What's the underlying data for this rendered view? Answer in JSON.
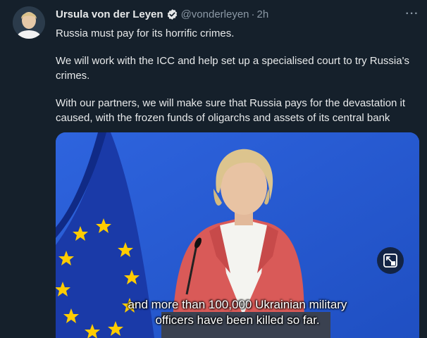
{
  "tweet": {
    "author_name": "Ursula von der Leyen",
    "handle": "@vonderleyen",
    "separator": "·",
    "time": "2h",
    "more_label": "···",
    "paragraphs": [
      "Russia must pay for its horrific crimes.",
      "We will work with the ICC and help set up a specialised court to try Russia's crimes.",
      "With our partners, we will make sure that Russia pays for the devastation it caused, with the frozen funds of oligarchs and assets of its central bank"
    ]
  },
  "media": {
    "caption_line1": "and more than 100,000 Ukrainian military",
    "caption_line2": "officers have been killed so far."
  },
  "colors": {
    "background": "#15202b",
    "text": "#e7e9ea",
    "secondary": "#8b98a5",
    "verified": "#1d9bf0",
    "eu_blue": "#003399",
    "eu_star": "#ffcc00",
    "jacket": "#d9534f"
  },
  "icons": {
    "verified": "verified-badge-icon",
    "more": "more-options-icon",
    "expand": "expand-media-icon"
  }
}
